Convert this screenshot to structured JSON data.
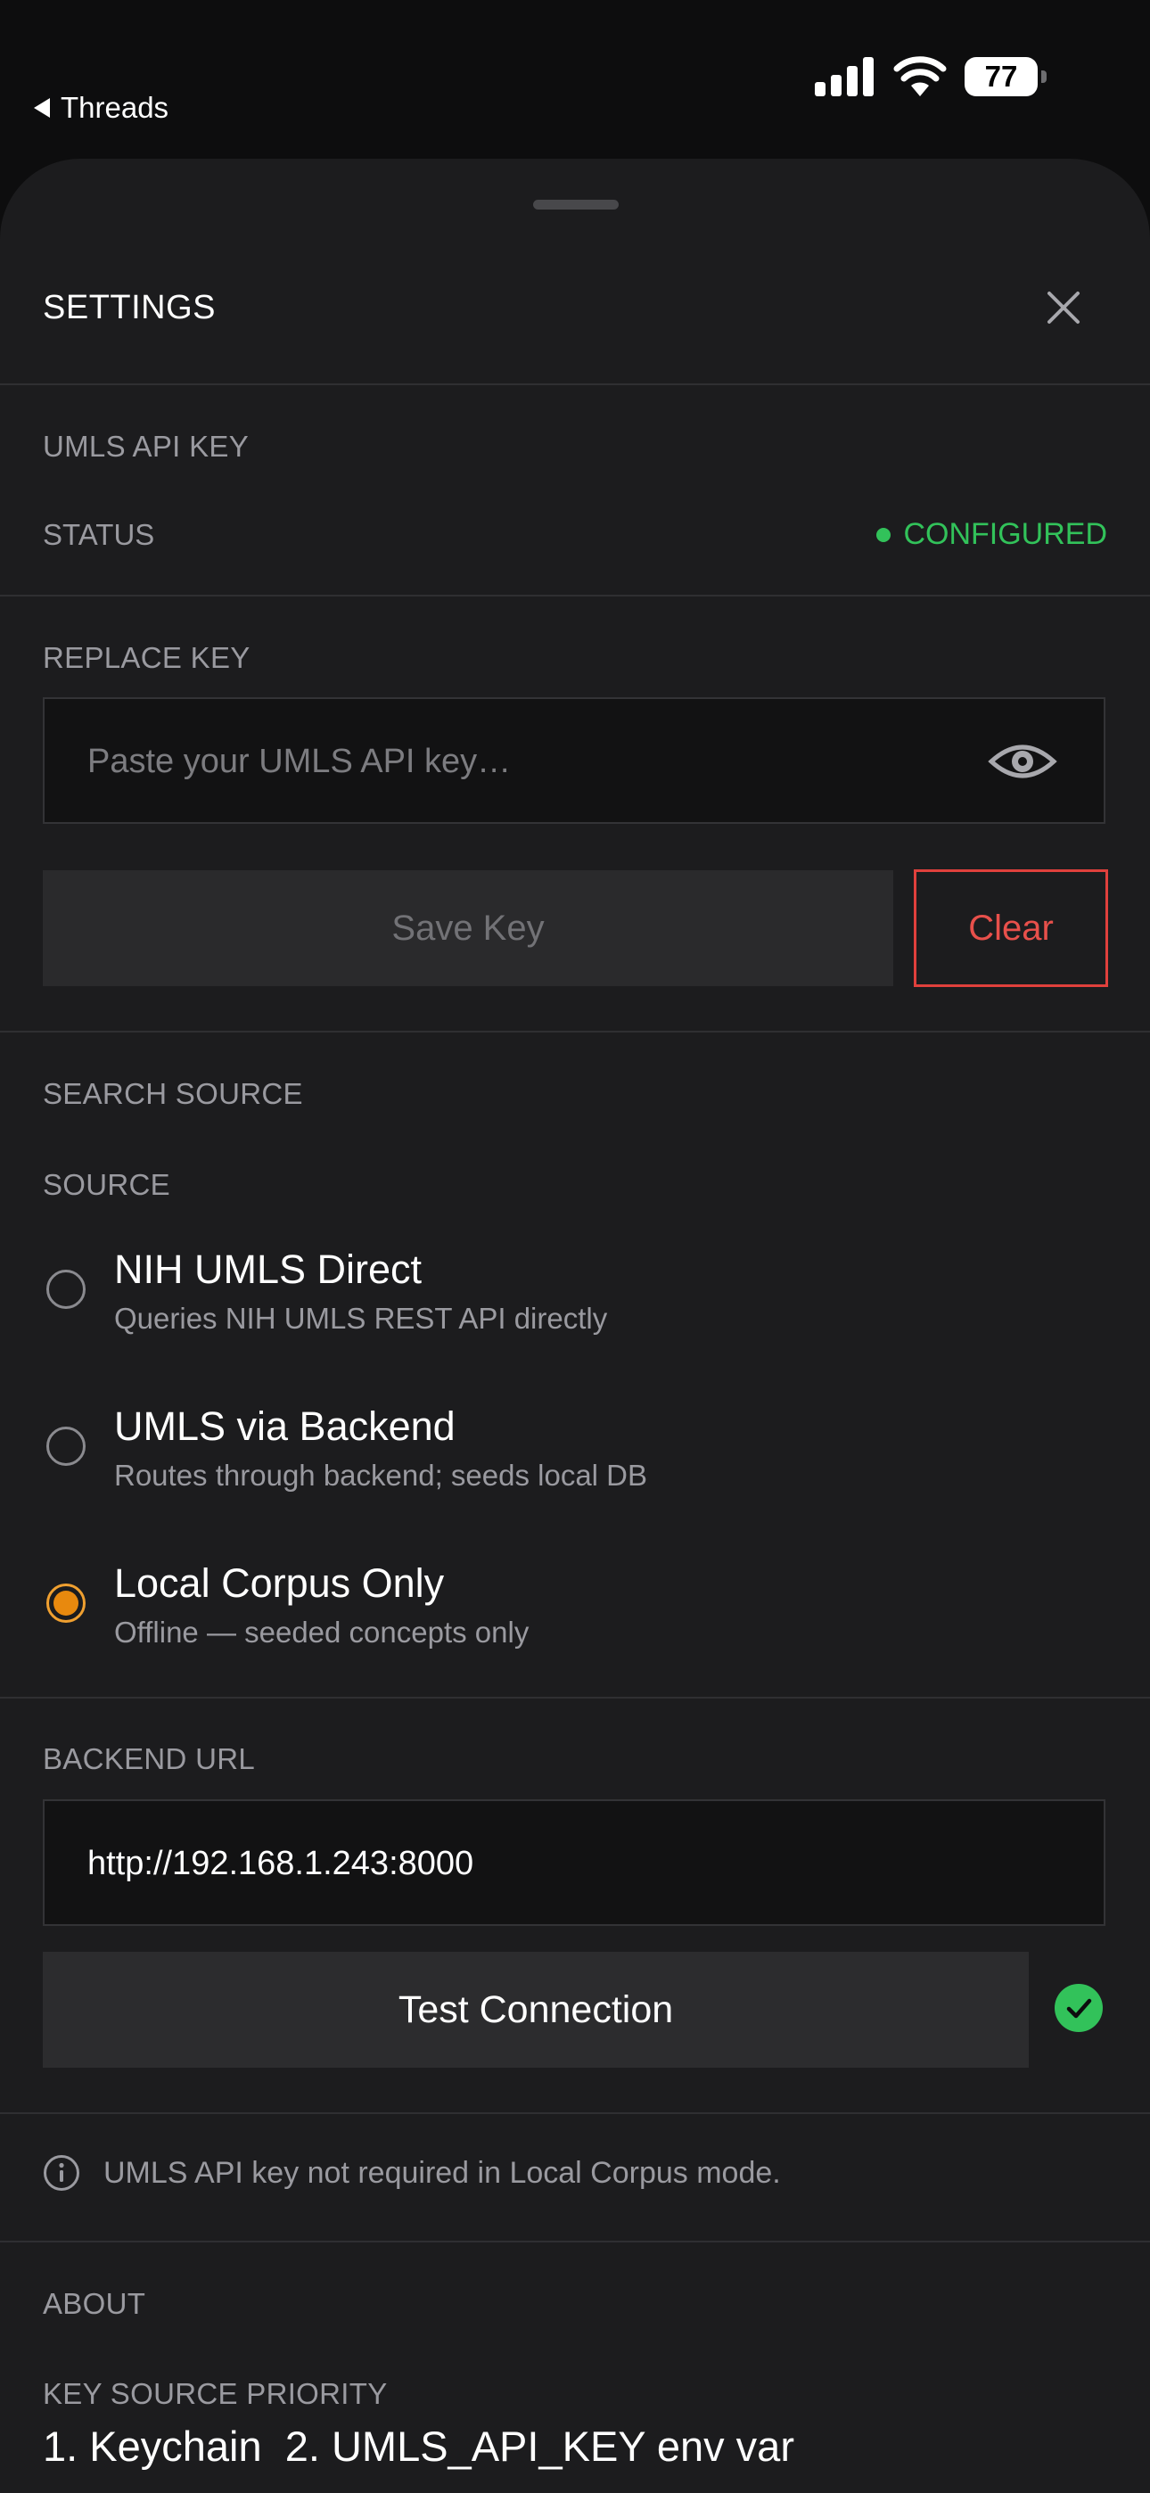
{
  "status_bar": {
    "back_app": "Threads",
    "battery_level": "77"
  },
  "sheet": {
    "title": "SETTINGS",
    "close_icon": "close-icon"
  },
  "umls_api_key": {
    "section_label": "UMLS API KEY",
    "status_label": "STATUS",
    "status_value": "CONFIGURED",
    "status_color": "#32c25a"
  },
  "replace_key": {
    "section_label": "REPLACE KEY",
    "input_value": "",
    "input_placeholder": "Paste your UMLS API key…",
    "save_label": "Save Key",
    "clear_label": "Clear"
  },
  "search_source": {
    "section_label": "SEARCH SOURCE",
    "source_label": "SOURCE",
    "options": [
      {
        "title": "NIH UMLS Direct",
        "subtitle": "Queries NIH UMLS REST API directly",
        "selected": false
      },
      {
        "title": "UMLS via Backend",
        "subtitle": "Routes through backend; seeds local DB",
        "selected": false
      },
      {
        "title": "Local Corpus Only",
        "subtitle": "Offline — seeded concepts only",
        "selected": true
      }
    ],
    "selected_color": "#e8890e"
  },
  "backend_url": {
    "section_label": "BACKEND URL",
    "input_value": "http://192.168.1.243:8000",
    "test_label": "Test Connection",
    "test_result_icon": "check-circle-icon",
    "test_result_color": "#32c25a"
  },
  "info": {
    "message": "UMLS API key not required in Local Corpus mode."
  },
  "about": {
    "section_label": "ABOUT",
    "priority_label": "KEY SOURCE PRIORITY",
    "priority_text": "1. Keychain  2. UMLS_API_KEY env var"
  }
}
